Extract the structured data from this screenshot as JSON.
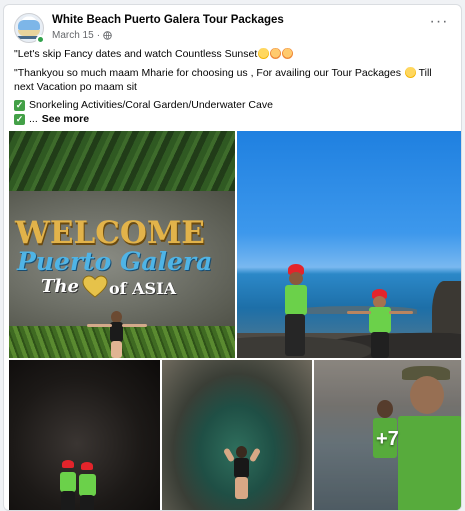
{
  "post": {
    "page_name": "White Beach Puerto Galera Tour Packages",
    "date": "March 15",
    "separator": "·",
    "more_label": "···",
    "text_line1": "\"Let's skip Fancy dates and watch Countless Sunset",
    "text_line2a": "\"Thankyou so much maam Mharie for choosing us , For availing our Tour Packages",
    "text_line2b": " Till next Vacation po maam sit",
    "text_line3": "Snorkeling Activities/Coral Garden/Underwater Cave",
    "text_line4_prefix": "...",
    "see_more": "See more"
  },
  "photos": {
    "sign_welcome": "WELCOME",
    "sign_puerto": "Puerto Galera",
    "sign_the": "The",
    "sign_asia": "of ASIA",
    "more_count": "+7"
  },
  "icons": {
    "globe": "globe-icon",
    "check": "check-icon",
    "heart": "heart-icon"
  },
  "colors": {
    "accent_check": "#43a047",
    "online": "#31a24c",
    "sign_gold": "#e2b34a",
    "sign_blue": "#4fb4e6"
  }
}
